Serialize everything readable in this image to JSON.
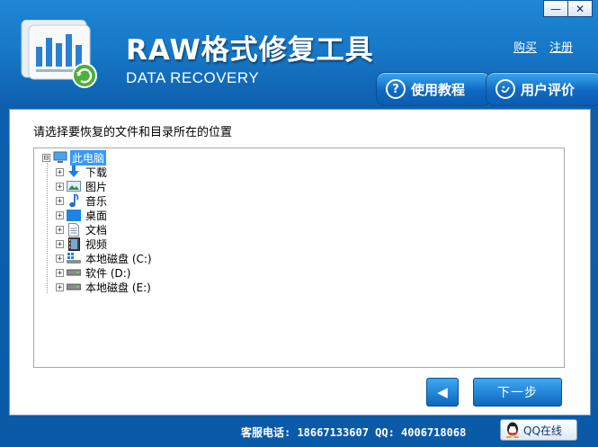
{
  "window": {
    "minimize_glyph": "—",
    "close_glyph": "✕"
  },
  "header": {
    "title": "RAW格式修复工具",
    "subtitle": "DATA RECOVERY",
    "links": {
      "buy": "购买",
      "register": "注册"
    },
    "buttons": {
      "tutorial": "使用教程",
      "review": "用户评价"
    },
    "tutorial_icon_glyph": "?"
  },
  "main": {
    "instruction": "请选择要恢复的文件和目录所在的位置",
    "tree": {
      "root": {
        "label": "此电脑",
        "icon": "computer-icon",
        "expander": "⊟"
      },
      "children": [
        {
          "label": "下载",
          "icon": "download-arrow-icon",
          "expander": "+"
        },
        {
          "label": "图片",
          "icon": "picture-icon",
          "expander": "+"
        },
        {
          "label": "音乐",
          "icon": "music-note-icon",
          "expander": "+"
        },
        {
          "label": "桌面",
          "icon": "desktop-icon",
          "expander": "+"
        },
        {
          "label": "文档",
          "icon": "document-icon",
          "expander": "+"
        },
        {
          "label": "视频",
          "icon": "video-icon",
          "expander": "+"
        },
        {
          "label": "本地磁盘 (C:)",
          "icon": "system-drive-icon",
          "expander": "+"
        },
        {
          "label": "软件 (D:)",
          "icon": "drive-icon",
          "expander": "+"
        },
        {
          "label": "本地磁盘 (E:)",
          "icon": "drive-icon",
          "expander": "+"
        }
      ]
    },
    "back_glyph": "◀",
    "next_label": "下一步"
  },
  "footer": {
    "service": "客服电话: 18667133607 QQ: 4006718068",
    "qq_label": "QQ在线"
  },
  "colors": {
    "header_blue": "#1677c6",
    "accent_blue": "#0d66bd",
    "selection": "#3399ff"
  }
}
